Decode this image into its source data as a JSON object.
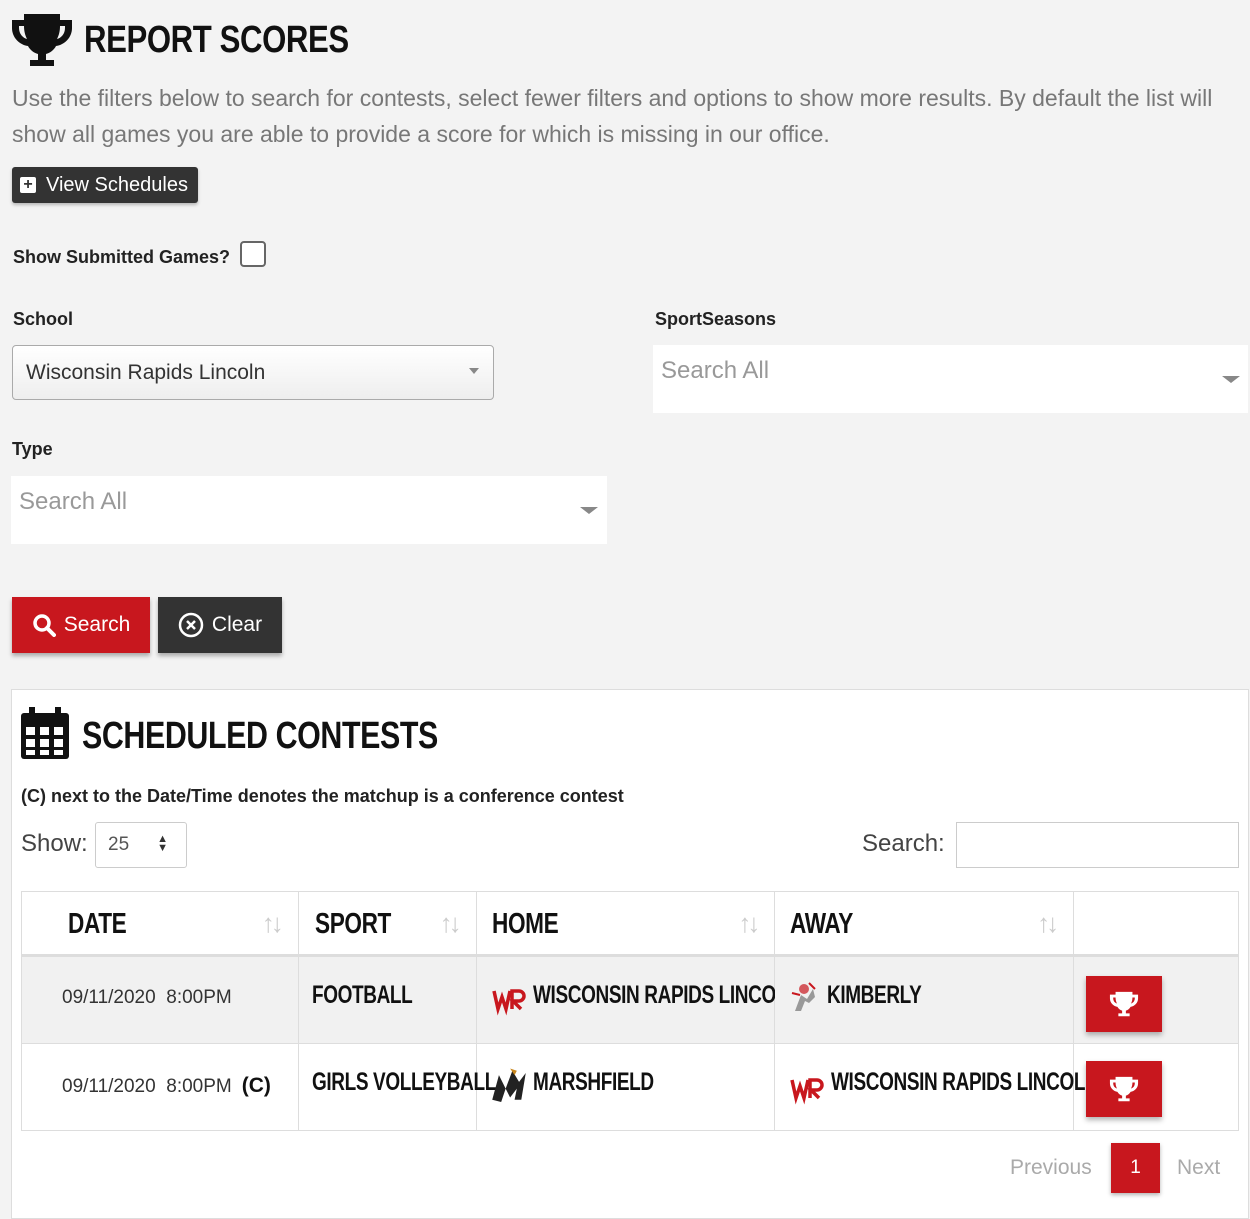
{
  "header": {
    "title": "REPORT SCORES",
    "intro": "Use the filters below to search for contests, select fewer filters and options to show more results. By default the list will show all games you are able to provide a score for which is missing in our office."
  },
  "filters": {
    "view_schedules_label": "View Schedules",
    "show_submitted_label": "Show Submitted Games?",
    "show_submitted_checked": false,
    "school_label": "School",
    "school_value": "Wisconsin Rapids Lincoln",
    "sportseasons_label": "SportSeasons",
    "sportseasons_placeholder": "Search All",
    "type_label": "Type",
    "type_placeholder": "Search All",
    "search_button": "Search",
    "clear_button": "Clear"
  },
  "contests": {
    "title": "SCHEDULED CONTESTS",
    "note": "(C) next to the Date/Time denotes the matchup is a conference contest",
    "show_label": "Show:",
    "page_size": "25",
    "search_label": "Search:",
    "columns": [
      "DATE",
      "SPORT",
      "HOME",
      "AWAY"
    ],
    "rows": [
      {
        "date": "09/11/2020",
        "time": "8:00PM",
        "conference": "",
        "sport": "FOOTBALL",
        "home": "WISCONSIN RAPIDS LINCOLN",
        "away": "KIMBERLY"
      },
      {
        "date": "09/11/2020",
        "time": "8:00PM",
        "conference": "(C)",
        "sport": "GIRLS VOLLEYBALL",
        "home": "MARSHFIELD",
        "away": "WISCONSIN RAPIDS LINCOLN"
      }
    ],
    "pagination": {
      "previous": "Previous",
      "current": "1",
      "next": "Next"
    }
  },
  "colors": {
    "accent": "#c8171e",
    "dark": "#333333"
  }
}
